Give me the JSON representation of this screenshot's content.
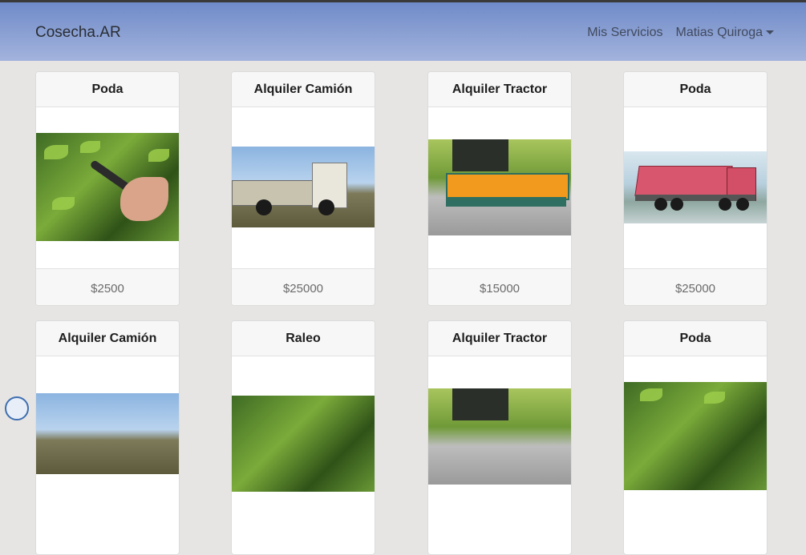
{
  "navbar": {
    "brand": "Cosecha.AR",
    "links": [
      "Mis Servicios"
    ],
    "user": "Matias Quiroga"
  },
  "cards": [
    {
      "title": "Poda",
      "price": "$2500",
      "image": "pruning-image"
    },
    {
      "title": "Alquiler Camión",
      "price": "$25000",
      "image": "truck-image"
    },
    {
      "title": "Alquiler Tractor",
      "price": "$15000",
      "image": "tractor-mower-image"
    },
    {
      "title": "Poda",
      "price": "$25000",
      "image": "dump-truck-image"
    },
    {
      "title": "Alquiler Camión",
      "image": "truck-image"
    },
    {
      "title": "Raleo",
      "image": "thinning-image"
    },
    {
      "title": "Alquiler Tractor",
      "image": "tractor-mower-image"
    },
    {
      "title": "Poda",
      "image": "pruning-image"
    }
  ],
  "colors": {
    "navbar_top": "#6f8bc9",
    "navbar_bottom": "#a3b3dc",
    "page_bg": "#e6e5e3"
  }
}
